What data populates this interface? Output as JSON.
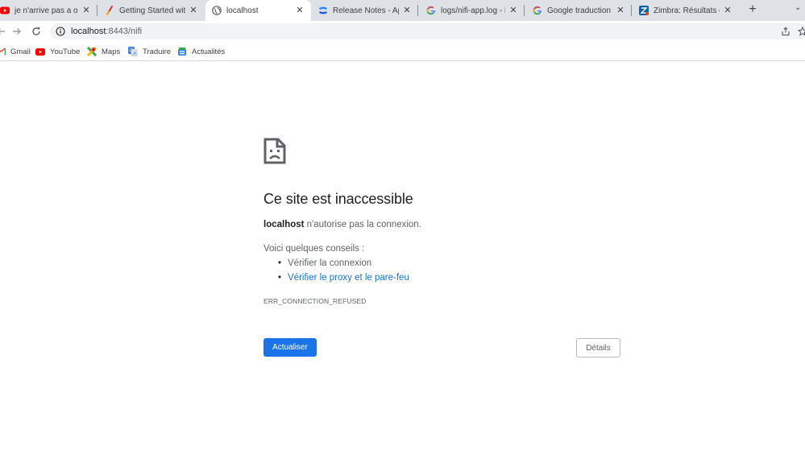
{
  "tabs": [
    {
      "title": "je n'arrive pas a ouvrir",
      "icon": "youtube-icon"
    },
    {
      "title": "Getting Started with A",
      "icon": "nifi-icon"
    },
    {
      "title": "localhost",
      "icon": "globe-icon",
      "active": true
    },
    {
      "title": "Release Notes - Apach",
      "icon": "confluence-icon"
    },
    {
      "title": "logs/nifi-app.log - Rec",
      "icon": "google-icon"
    },
    {
      "title": "Google traduction - R",
      "icon": "google-icon"
    },
    {
      "title": "Zimbra: Résultats de r",
      "icon": "zimbra-icon"
    }
  ],
  "toolbar": {
    "url_host": "localhost",
    "url_path": ":8443/nifi"
  },
  "bookmarks": [
    {
      "label": "Gmail",
      "icon": "gmail-icon"
    },
    {
      "label": "YouTube",
      "icon": "youtube-icon"
    },
    {
      "label": "Maps",
      "icon": "maps-icon"
    },
    {
      "label": "Traduire",
      "icon": "translate-icon"
    },
    {
      "label": "Actualités",
      "icon": "news-icon"
    }
  ],
  "error": {
    "title": "Ce site est inaccessible",
    "host": "localhost",
    "description": " n'autorise pas la connexion.",
    "tips_heading": "Voici quelques conseils :",
    "tips": [
      "Vérifier la connexion",
      "Vérifier le proxy et le pare-feu"
    ],
    "code": "ERR_CONNECTION_REFUSED",
    "reload_label": "Actualiser",
    "details_label": "Détails"
  },
  "colors": {
    "accent": "#1a73e8",
    "tabstrip": "#dee1e6",
    "text_secondary": "#5f6368"
  }
}
